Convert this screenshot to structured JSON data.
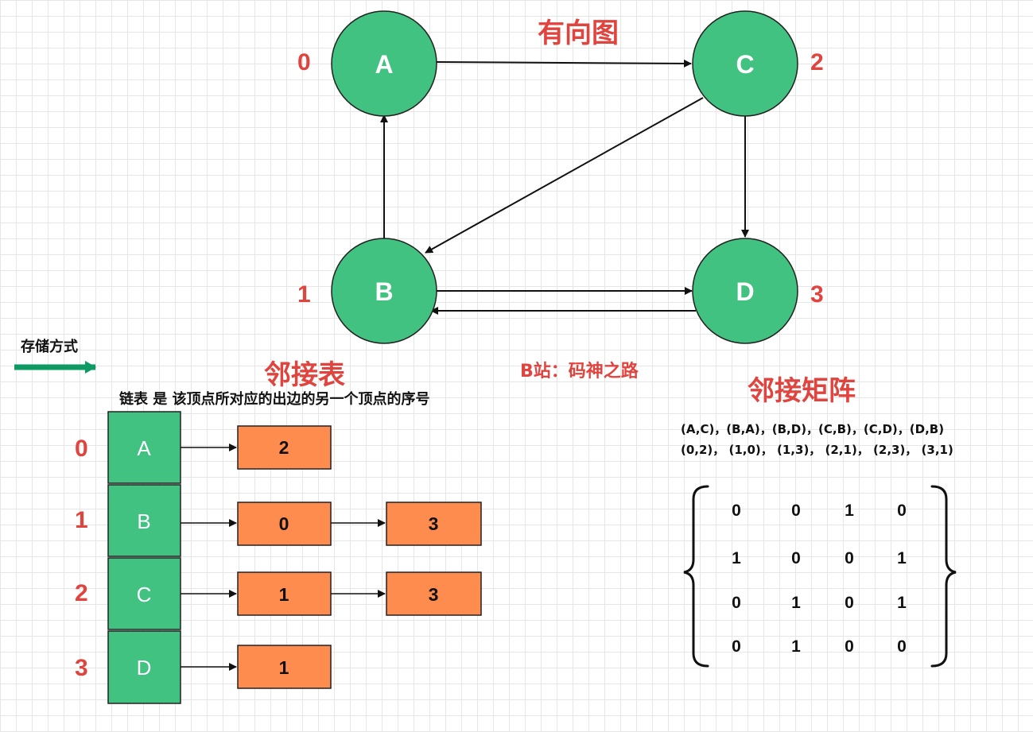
{
  "graph": {
    "title": "有向图",
    "nodes": [
      {
        "name": "A",
        "index": "0"
      },
      {
        "name": "B",
        "index": "1"
      },
      {
        "name": "C",
        "index": "2"
      },
      {
        "name": "D",
        "index": "3"
      }
    ],
    "edges": [
      [
        "A",
        "C"
      ],
      [
        "B",
        "A"
      ],
      [
        "B",
        "D"
      ],
      [
        "C",
        "B"
      ],
      [
        "C",
        "D"
      ],
      [
        "D",
        "B"
      ]
    ],
    "node_color": "#41c280",
    "watermark": "B站：码神之路"
  },
  "storage": {
    "label": "存储方式",
    "arrow_color": "#0e9a63"
  },
  "adjacency_list": {
    "title": "邻接表",
    "description": "链表 是 该顶点所对应的出边的另一个顶点的序号",
    "rows": [
      {
        "index": "0",
        "vertex": "A",
        "links": [
          "2"
        ]
      },
      {
        "index": "1",
        "vertex": "B",
        "links": [
          "0",
          "3"
        ]
      },
      {
        "index": "2",
        "vertex": "C",
        "links": [
          "1",
          "3"
        ]
      },
      {
        "index": "3",
        "vertex": "D",
        "links": [
          "1"
        ]
      }
    ],
    "vertex_color": "#41c280",
    "link_color": "#ff8c4f"
  },
  "adjacency_matrix": {
    "title": "邻接矩阵",
    "edge_pairs": "(A,C)，(B,A)，(B,D)，(C,B)，(C,D)，(D,B)",
    "index_pairs": "(0,2)， (1,0)， (1,3)， (2,1)， (2,3)， (3,1)",
    "matrix": [
      [
        "0",
        "0",
        "1",
        "0"
      ],
      [
        "1",
        "0",
        "0",
        "1"
      ],
      [
        "0",
        "1",
        "0",
        "1"
      ],
      [
        "0",
        "1",
        "0",
        "0"
      ]
    ]
  },
  "accent_color": "#e0443f"
}
